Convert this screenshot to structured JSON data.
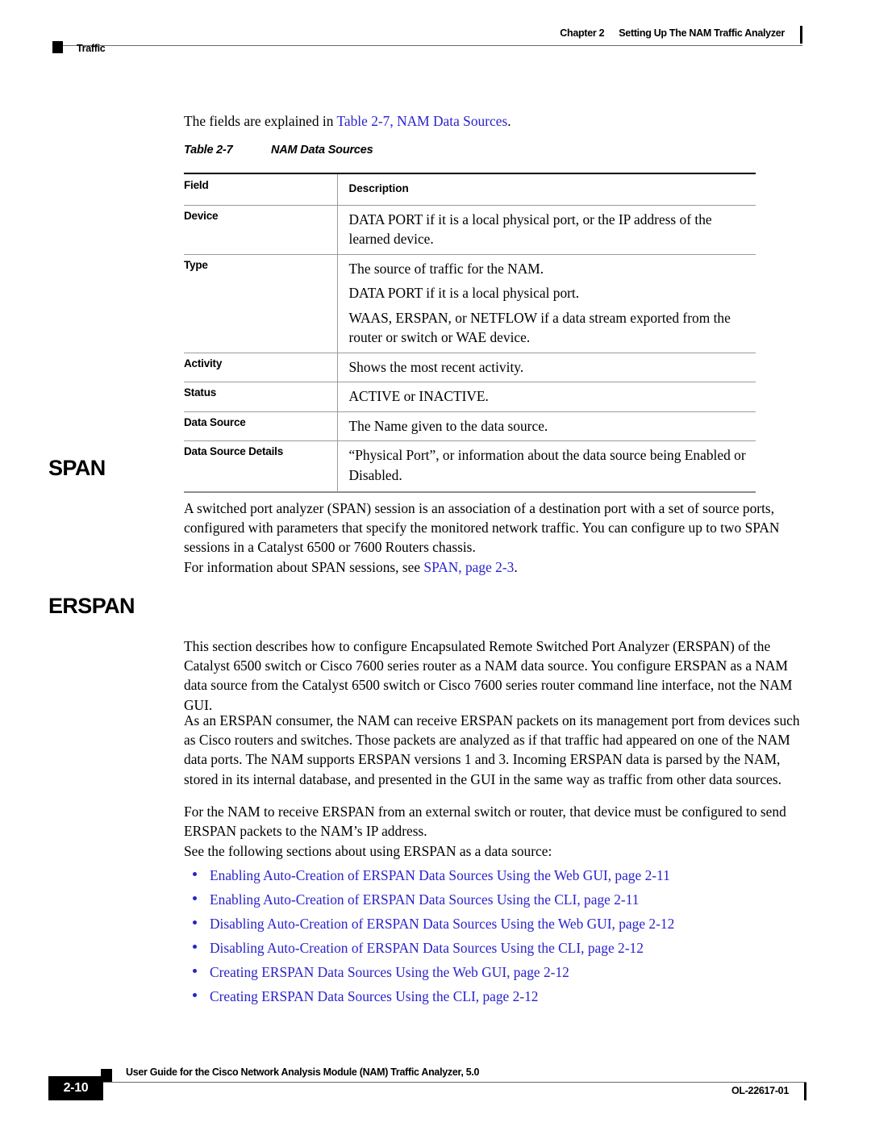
{
  "header": {
    "left_label": "Traffic",
    "chapter": "Chapter 2",
    "chapter_title": "Setting Up The NAM Traffic Analyzer"
  },
  "intro": {
    "lead_prefix": "The fields are explained in ",
    "lead_link": "Table 2-7, NAM Data Sources",
    "lead_suffix": "."
  },
  "table": {
    "caption_number": "Table 2-7",
    "caption_title": "NAM Data Sources",
    "headers": [
      "Field",
      "Description"
    ],
    "rows": [
      {
        "field": "Device",
        "paragraphs": [
          "DATA PORT if it is a local physical port, or the IP address of the learned device."
        ]
      },
      {
        "field": "Type",
        "paragraphs": [
          "The source of traffic for the NAM.",
          "DATA PORT if it is a local physical port.",
          "WAAS, ERSPAN, or NETFLOW if a data stream exported from the router or switch or WAE device."
        ]
      },
      {
        "field": "Activity",
        "paragraphs": [
          "Shows the most recent activity."
        ]
      },
      {
        "field": "Status",
        "paragraphs": [
          "ACTIVE or INACTIVE."
        ]
      },
      {
        "field": "Data Source",
        "paragraphs": [
          "The Name given to the data source."
        ]
      },
      {
        "field": "Data Source Details",
        "paragraphs": [
          "“Physical Port”, or information about the data source being Enabled or Disabled."
        ]
      }
    ]
  },
  "span": {
    "heading": "SPAN",
    "para1": "A switched port analyzer (SPAN) session is an association of a destination port with a set of source ports, configured with parameters that specify the monitored network traffic. You can configure up to two SPAN sessions in a Catalyst 6500 or 7600 Routers chassis.",
    "para2_prefix": "For information about SPAN sessions, see ",
    "para2_link": "SPAN, page 2-3",
    "para2_suffix": "."
  },
  "erspan": {
    "heading": "ERSPAN",
    "para1": "This section describes how to configure Encapsulated Remote Switched Port Analyzer (ERSPAN) of the Catalyst 6500 switch or Cisco 7600 series router as a NAM data source. You configure ERSPAN as a NAM data source from the Catalyst 6500 switch or Cisco 7600 series router command line interface, not the NAM GUI.",
    "para2": "As an ERSPAN consumer, the NAM can receive ERSPAN packets on its management port from devices such as Cisco routers and switches. Those packets are analyzed as if that traffic had appeared on one of the NAM data ports. The NAM supports ERSPAN versions 1 and 3. Incoming ERSPAN data is parsed by the NAM, stored in its internal database, and presented in the GUI in the same way as traffic from other data sources.",
    "para3": "For the NAM to receive ERSPAN from an external switch or router, that device must be configured to send ERSPAN packets to the NAM’s IP address.",
    "para4": "See the following sections about using ERSPAN as a data source:",
    "links": [
      "Enabling Auto-Creation of ERSPAN Data Sources Using the Web GUI, page 2-11",
      "Enabling Auto-Creation of ERSPAN Data Sources Using the CLI, page 2-11",
      "Disabling Auto-Creation of ERSPAN Data Sources Using the Web GUI, page 2-12",
      "Disabling Auto-Creation of ERSPAN Data Sources Using the CLI, page 2-12",
      "Creating ERSPAN Data Sources Using the Web GUI, page 2-12",
      "Creating ERSPAN Data Sources Using the CLI, page 2-12"
    ]
  },
  "footer": {
    "page_number": "2-10",
    "guide_title": "User Guide for the Cisco Network Analysis Module (NAM) Traffic Analyzer, 5.0",
    "doc_id": "OL-22617-01"
  },
  "colors": {
    "link": "#2a22cc",
    "rule": "#6a6a6a",
    "text": "#000000"
  }
}
